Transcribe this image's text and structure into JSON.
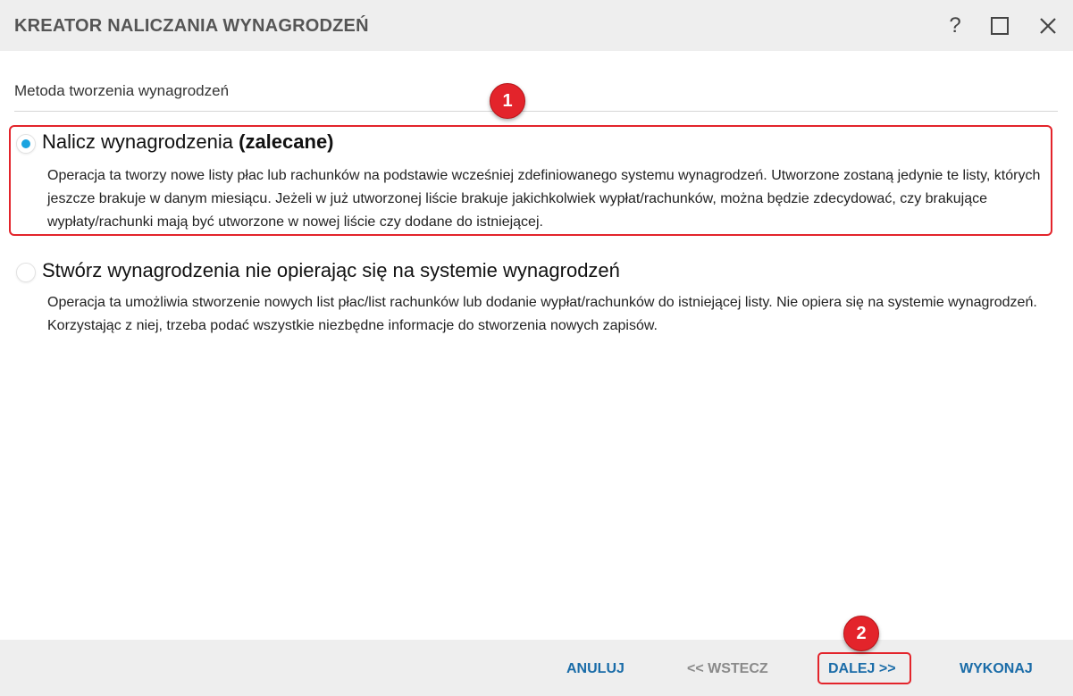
{
  "window": {
    "title": "KREATOR NALICZANIA WYNAGRODZEŃ",
    "help_label": "?"
  },
  "section": {
    "label": "Metoda tworzenia wynagrodzeń"
  },
  "options": [
    {
      "title": "Nalicz wynagrodzenia",
      "title_suffix": "(zalecane)",
      "description": "Operacja ta tworzy nowe listy płac lub rachunków na podstawie wcześniej zdefiniowanego systemu wynagrodzeń. Utworzone zostaną jedynie te listy, których jeszcze brakuje w danym miesiącu. Jeżeli w już utworzonej liście brakuje jakichkolwiek wypłat/rachunków, można będzie zdecydować, czy brakujące wypłaty/rachunki mają być utworzone w nowej liście czy dodane do istniejącej.",
      "selected": true
    },
    {
      "title": "Stwórz wynagrodzenia nie opierając się na systemie wynagrodzeń",
      "description": "Operacja ta umożliwia stworzenie nowych list płac/list rachunków lub dodanie wypłat/rachunków do istniejącej listy. Nie opiera się na systemie wynagrodzeń. Korzystając z niej, trzeba podać wszystkie niezbędne informacje do stworzenia nowych zapisów.",
      "selected": false
    }
  ],
  "annotations": {
    "badge_1": "1",
    "badge_2": "2",
    "color": "#e3242b"
  },
  "footer": {
    "cancel": "ANULUJ",
    "back": "<< WSTECZ",
    "next": "DALEJ >>",
    "finish": "WYKONAJ"
  },
  "colors": {
    "accent": "#1aa3e0",
    "button_text": "#1a6ca8",
    "disabled_text": "#8a8a8a",
    "bar_background": "#eeeeee"
  }
}
